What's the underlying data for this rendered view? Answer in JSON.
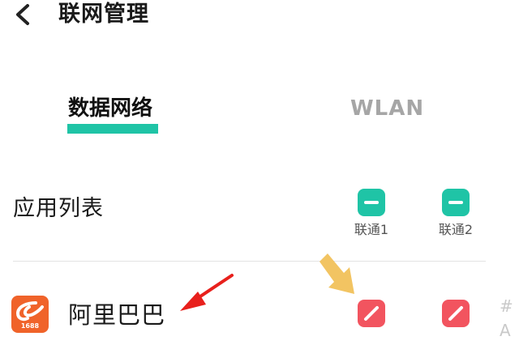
{
  "header": {
    "title": "联网管理"
  },
  "tabs": [
    {
      "label": "数据网络",
      "active": true
    },
    {
      "label": "WLAN",
      "active": false
    }
  ],
  "section": {
    "label": "应用列表"
  },
  "columns": [
    {
      "label": "联通1"
    },
    {
      "label": "联通2"
    }
  ],
  "apps": [
    {
      "name": "阿里巴巴",
      "icon_text": "1688",
      "sim1_allowed": false,
      "sim2_allowed": false
    }
  ],
  "edge_text": [
    "#",
    "A"
  ],
  "colors": {
    "accent": "#1fc4a6",
    "blocked": "#f2545f",
    "app_icon": "#f0632a",
    "annotation_red": "#e8201c",
    "annotation_yellow": "#f2c462",
    "inactive_tab": "#a6a6a6"
  },
  "icons": {
    "back": "chevron-left-icon",
    "column_toggle": "minus-icon",
    "blocked_toggle": "slash-icon"
  }
}
